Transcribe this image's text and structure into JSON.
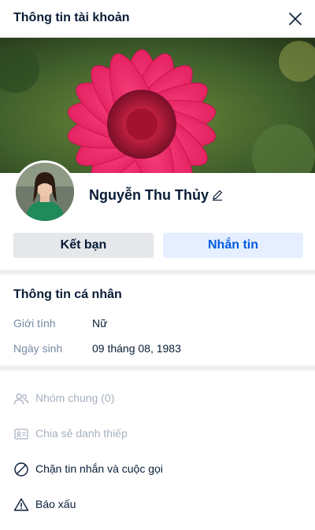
{
  "header": {
    "title": "Thông tin tài khoản"
  },
  "profile": {
    "name": "Nguyễn Thu Thủy"
  },
  "actions": {
    "add_friend_label": "Kết bạn",
    "message_label": "Nhắn tin"
  },
  "personal_info": {
    "title": "Thông tin cá nhân",
    "gender_label": "Giới tính",
    "gender_value": "Nữ",
    "birthday_label": "Ngày sinh",
    "birthday_value": "09 tháng 08, 1983"
  },
  "menu": {
    "common_groups": "Nhóm chung (0)",
    "share_card": "Chia sẻ danh thiếp",
    "block": "Chặn tin nhắn và cuộc gọi",
    "report": "Báo xấu"
  },
  "colors": {
    "primary": "#005ae0",
    "primary_light": "#e5efff",
    "text": "#081c36",
    "muted": "#7589a3",
    "disabled": "#a6b1bf"
  }
}
